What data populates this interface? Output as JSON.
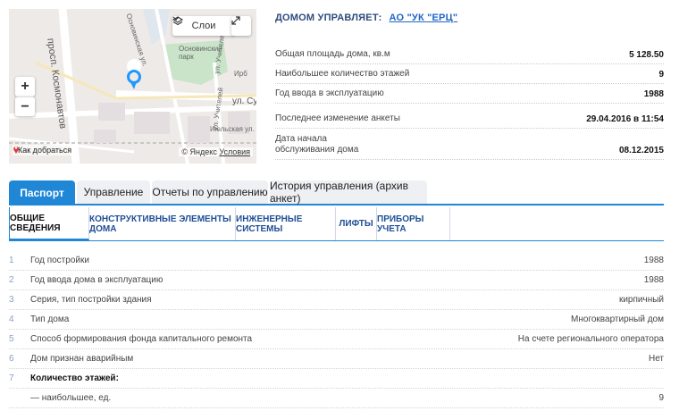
{
  "map": {
    "layers_label": "Слои",
    "route_label": "Как добраться",
    "copyright": "© Яндекс",
    "terms": "Условия",
    "streets": {
      "kosmonavtov": "просп. Космонавтов",
      "osnovinskaya": "Основинская ул.",
      "park": "Основинский парк",
      "irb": "Ирб",
      "uchiteley": "ул. Учителей",
      "uchiteley2": "ул. Учителей",
      "su": "ул. Су",
      "yulskaya": "Июльская ул."
    }
  },
  "info": {
    "managed_label": "ДОМОМ УПРАВЛЯЕТ:",
    "managed_company": "АО \"УК \"ЕРЦ\"",
    "rows": [
      {
        "label": "Общая площадь дома, кв.м",
        "value": "5 128.50"
      },
      {
        "label": "Наибольшее количество этажей",
        "value": "9"
      },
      {
        "label": "Год ввода в эксплуатацию",
        "value": "1988"
      },
      {
        "label": "Последнее изменение анкеты",
        "value": "29.04.2016 в 11:54"
      },
      {
        "label_line1": "Дата начала",
        "label_line2": "обслуживания дома",
        "value": "08.12.2015"
      }
    ]
  },
  "tabs": [
    "Паспорт",
    "Управление",
    "Отчеты по управлению",
    "История управления (архив анкет)"
  ],
  "subtabs": [
    "ОБЩИЕ СВЕДЕНИЯ",
    "КОНСТРУКТИВНЫЕ ЭЛЕМЕНТЫ ДОМА",
    "ИНЖЕНЕРНЫЕ СИСТЕМЫ",
    "ЛИФТЫ",
    "ПРИБОРЫ УЧЕТА"
  ],
  "details": [
    {
      "num": "1",
      "name": "Год постройки",
      "value": "1988"
    },
    {
      "num": "2",
      "name": "Год ввода дома в эксплуатацию",
      "value": "1988"
    },
    {
      "num": "3",
      "name": "Серия, тип постройки здания",
      "value": "кирпичный"
    },
    {
      "num": "4",
      "name": "Тип дома",
      "value": "Многоквартирный дом"
    },
    {
      "num": "5",
      "name": "Способ формирования фонда капитального ремонта",
      "value": "На счете регионального оператора"
    },
    {
      "num": "6",
      "name": "Дом признан аварийным",
      "value": "Нет"
    },
    {
      "num": "7",
      "name": "Количество этажей:",
      "value": ""
    },
    {
      "num": "",
      "name": "— наибольшее, ед.",
      "value": "9"
    }
  ]
}
